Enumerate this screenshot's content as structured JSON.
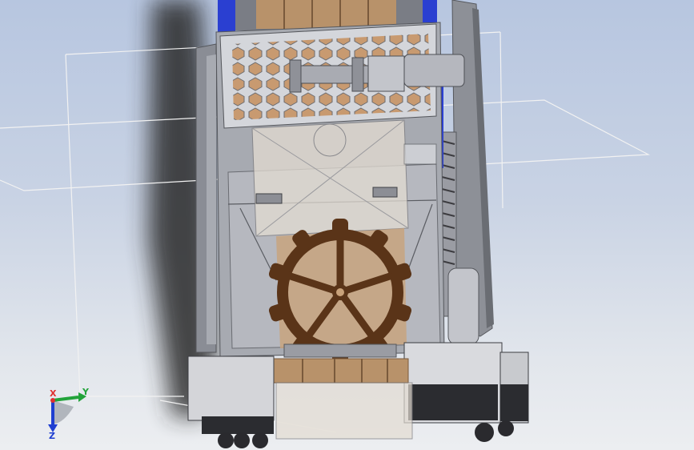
{
  "window": {
    "background_top": "#b7c6e0",
    "background_bottom": "#eceef1"
  },
  "model": {
    "frame_color": "#8a8d95",
    "plate_color": "#c4c6cc",
    "accent_color": "#2a3fd1",
    "roller_color": "#b8926a",
    "gear_color": "#5a3418"
  },
  "triad": {
    "x_label": "X",
    "y_label": "Y",
    "z_label": "Z",
    "x_color": "#e03030",
    "y_color": "#22a33a",
    "z_color": "#1f3fd1"
  }
}
